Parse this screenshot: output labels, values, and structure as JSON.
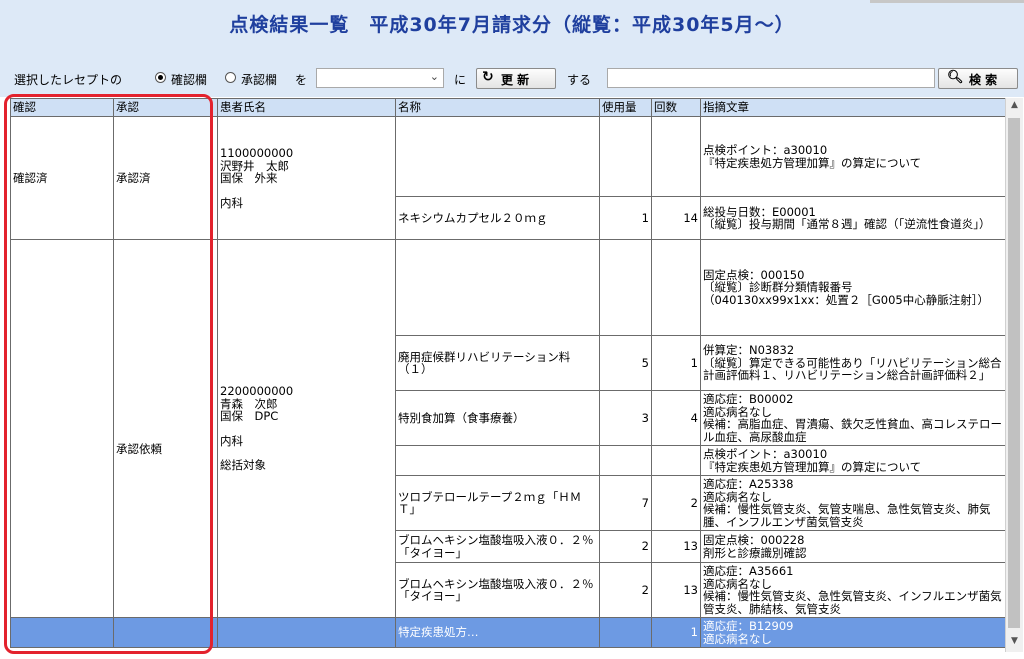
{
  "title": "点検結果一覧　平成30年7月請求分（縦覧：平成30年5月〜）",
  "toolbar": {
    "prefix": "選択したレセプトの",
    "radio_confirm": "確認欄",
    "radio_approve": "承認欄",
    "wo": "を",
    "select_value": "",
    "ni": "に",
    "update_label": "更 新",
    "update_icon": "refresh-icon",
    "suru": "する",
    "search_value": "",
    "search_label": "検 索",
    "search_icon": "search-icon"
  },
  "columns": [
    "確認",
    "承認",
    "患者氏名",
    "名称",
    "使用量",
    "回数",
    "指摘文章"
  ],
  "patients": [
    {
      "confirm": "確認済",
      "approve": "承認済",
      "id": "1100000000",
      "name": "沢野井　太郎",
      "insurance": "国保　外来",
      "dept": "内科",
      "note": "",
      "rows": [
        {
          "item": "",
          "qty": "",
          "count": "",
          "text": "点検ポイント：a30010\n『特定疾患処方管理加算』の算定について"
        },
        {
          "item": "ネキシウムカプセル２０ｍｇ",
          "qty": "1",
          "count": "14",
          "text": "総投与日数：E00001\n〔縦覧〕投与期間「通常８週」確認（「逆流性食道炎」）"
        }
      ]
    },
    {
      "confirm": "",
      "approve": "承認依頼",
      "id": "2200000000",
      "name": "青森　次郎",
      "insurance": "国保　DPC",
      "dept": "内科",
      "note": "総括対象",
      "rows": [
        {
          "item": "",
          "qty": "",
          "count": "",
          "text": "固定点検：000150\n〔縦覧〕診断群分類情報番号\n（040130xx99x1xx：処置２［G005中心静脈注射］）"
        },
        {
          "item": "廃用症候群リハビリテーション料（１）",
          "qty": "5",
          "count": "1",
          "text": "併算定：N03832\n〔縦覧〕算定できる可能性あり「リハビリテーション総合計画評価料１、リハビリテーション総合計画評価料２」"
        },
        {
          "item": "特別食加算（食事療養）",
          "qty": "3",
          "count": "4",
          "text": "適応症：B00002\n適応病名なし\n候補：高脂血症、胃潰瘍、鉄欠乏性貧血、高コレステロール血症、高尿酸血症"
        },
        {
          "item": "",
          "qty": "",
          "count": "",
          "text": "点検ポイント：a30010\n『特定疾患処方管理加算』の算定について"
        },
        {
          "item": "ツロブテロールテープ２ｍｇ「ＨＭＴ」",
          "qty": "7",
          "count": "2",
          "text": "適応症：A25338\n適応病名なし\n候補：慢性気管支炎、気管支喘息、急性気管支炎、肺気腫、インフルエンザ菌気管支炎"
        },
        {
          "item": "ブロムヘキシン塩酸塩吸入液０．２％「タイヨー」",
          "qty": "2",
          "count": "13",
          "text": "固定点検：000228\n剤形と診療識別確認"
        },
        {
          "item": "ブロムヘキシン塩酸塩吸入液０．２％「タイヨー」",
          "qty": "2",
          "count": "13",
          "text": "適応症：A35661\n適応病名なし\n候補：慢性気管支炎、急性気管支炎、インフルエンザ菌気管支炎、肺結核、気管支炎"
        }
      ]
    }
  ],
  "selected_row": {
    "item": "特定疾患処方…",
    "qty": "",
    "count": "1",
    "text": "適応症：B12909\n適応病名なし"
  },
  "colors": {
    "title": "#1f3f9e",
    "header_bg": "#dde9f7",
    "column_header_bg": "#cfe0f5",
    "selected_row": "#6d9ae3",
    "highlight": "#e3222d"
  }
}
